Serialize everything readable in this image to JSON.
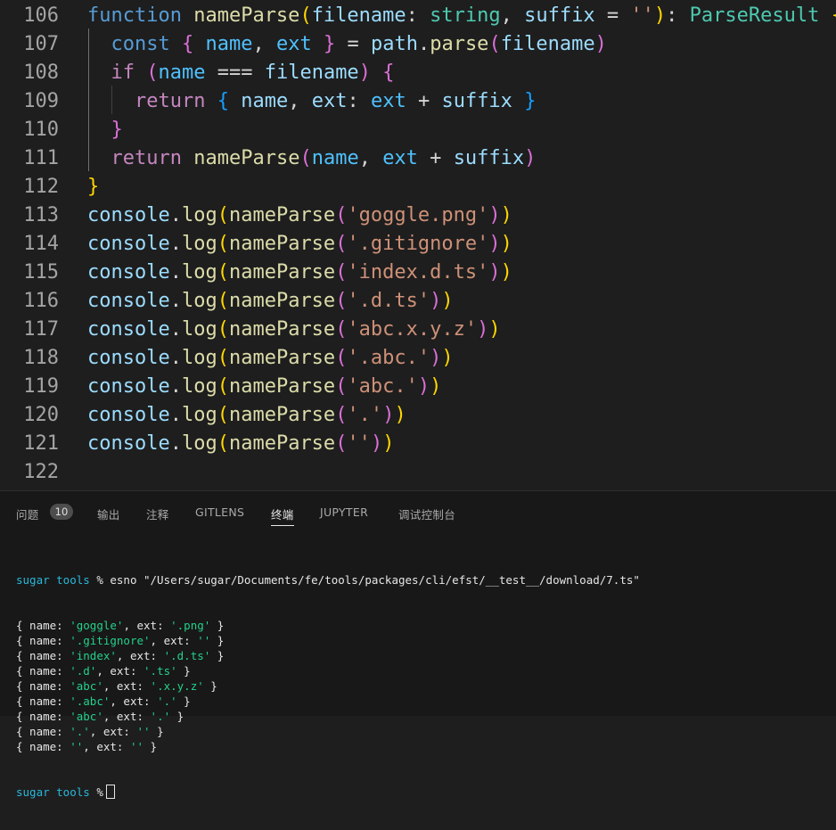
{
  "editor": {
    "lines": [
      {
        "num": "106",
        "tokens": [
          {
            "t": "function",
            "c": "kw"
          },
          {
            "t": " ",
            "c": "txt"
          },
          {
            "t": "nameParse",
            "c": "fn"
          },
          {
            "t": "(",
            "c": "b1"
          },
          {
            "t": "filename",
            "c": "var"
          },
          {
            "t": ": ",
            "c": "txt"
          },
          {
            "t": "string",
            "c": "type"
          },
          {
            "t": ", ",
            "c": "txt"
          },
          {
            "t": "suffix",
            "c": "var"
          },
          {
            "t": " = ",
            "c": "txt"
          },
          {
            "t": "''",
            "c": "str"
          },
          {
            "t": ")",
            "c": "b1"
          },
          {
            "t": ": ",
            "c": "txt"
          },
          {
            "t": "ParseResult",
            "c": "type"
          },
          {
            "t": " ",
            "c": "txt"
          },
          {
            "t": "{",
            "c": "b1"
          }
        ]
      },
      {
        "num": "107",
        "tokens": [
          {
            "t": "  ",
            "c": "txt"
          },
          {
            "t": "const",
            "c": "kw"
          },
          {
            "t": " ",
            "c": "txt"
          },
          {
            "t": "{",
            "c": "b2"
          },
          {
            "t": " ",
            "c": "txt"
          },
          {
            "t": "name",
            "c": "const"
          },
          {
            "t": ", ",
            "c": "txt"
          },
          {
            "t": "ext",
            "c": "const"
          },
          {
            "t": " ",
            "c": "txt"
          },
          {
            "t": "}",
            "c": "b2"
          },
          {
            "t": " = ",
            "c": "txt"
          },
          {
            "t": "path",
            "c": "var"
          },
          {
            "t": ".",
            "c": "txt"
          },
          {
            "t": "parse",
            "c": "fn"
          },
          {
            "t": "(",
            "c": "b2"
          },
          {
            "t": "filename",
            "c": "var"
          },
          {
            "t": ")",
            "c": "b2"
          }
        ]
      },
      {
        "num": "108",
        "tokens": [
          {
            "t": "  ",
            "c": "txt"
          },
          {
            "t": "if",
            "c": "ctl"
          },
          {
            "t": " ",
            "c": "txt"
          },
          {
            "t": "(",
            "c": "b2"
          },
          {
            "t": "name",
            "c": "const"
          },
          {
            "t": " === ",
            "c": "txt"
          },
          {
            "t": "filename",
            "c": "var"
          },
          {
            "t": ")",
            "c": "b2"
          },
          {
            "t": " ",
            "c": "txt"
          },
          {
            "t": "{",
            "c": "b2"
          }
        ]
      },
      {
        "num": "109",
        "tokens": [
          {
            "t": "    ",
            "c": "txt"
          },
          {
            "t": "return",
            "c": "ctl"
          },
          {
            "t": " ",
            "c": "txt"
          },
          {
            "t": "{",
            "c": "b3"
          },
          {
            "t": " ",
            "c": "txt"
          },
          {
            "t": "name",
            "c": "var"
          },
          {
            "t": ", ",
            "c": "txt"
          },
          {
            "t": "ext",
            "c": "var"
          },
          {
            "t": ": ",
            "c": "txt"
          },
          {
            "t": "ext",
            "c": "const"
          },
          {
            "t": " + ",
            "c": "txt"
          },
          {
            "t": "suffix",
            "c": "var"
          },
          {
            "t": " ",
            "c": "txt"
          },
          {
            "t": "}",
            "c": "b3"
          }
        ]
      },
      {
        "num": "110",
        "tokens": [
          {
            "t": "  ",
            "c": "txt"
          },
          {
            "t": "}",
            "c": "b2"
          }
        ]
      },
      {
        "num": "111",
        "tokens": [
          {
            "t": "  ",
            "c": "txt"
          },
          {
            "t": "return",
            "c": "ctl"
          },
          {
            "t": " ",
            "c": "txt"
          },
          {
            "t": "nameParse",
            "c": "fn"
          },
          {
            "t": "(",
            "c": "b2"
          },
          {
            "t": "name",
            "c": "const"
          },
          {
            "t": ", ",
            "c": "txt"
          },
          {
            "t": "ext",
            "c": "const"
          },
          {
            "t": " + ",
            "c": "txt"
          },
          {
            "t": "suffix",
            "c": "var"
          },
          {
            "t": ")",
            "c": "b2"
          }
        ]
      },
      {
        "num": "112",
        "tokens": [
          {
            "t": "}",
            "c": "b1"
          }
        ]
      },
      {
        "num": "113",
        "tokens": [
          {
            "t": "console",
            "c": "var"
          },
          {
            "t": ".",
            "c": "txt"
          },
          {
            "t": "log",
            "c": "fn"
          },
          {
            "t": "(",
            "c": "b1"
          },
          {
            "t": "nameParse",
            "c": "fn"
          },
          {
            "t": "(",
            "c": "b2"
          },
          {
            "t": "'goggle.png'",
            "c": "str"
          },
          {
            "t": ")",
            "c": "b2"
          },
          {
            "t": ")",
            "c": "b1"
          }
        ]
      },
      {
        "num": "114",
        "tokens": [
          {
            "t": "console",
            "c": "var"
          },
          {
            "t": ".",
            "c": "txt"
          },
          {
            "t": "log",
            "c": "fn"
          },
          {
            "t": "(",
            "c": "b1"
          },
          {
            "t": "nameParse",
            "c": "fn"
          },
          {
            "t": "(",
            "c": "b2"
          },
          {
            "t": "'.gitignore'",
            "c": "str"
          },
          {
            "t": ")",
            "c": "b2"
          },
          {
            "t": ")",
            "c": "b1"
          }
        ]
      },
      {
        "num": "115",
        "tokens": [
          {
            "t": "console",
            "c": "var"
          },
          {
            "t": ".",
            "c": "txt"
          },
          {
            "t": "log",
            "c": "fn"
          },
          {
            "t": "(",
            "c": "b1"
          },
          {
            "t": "nameParse",
            "c": "fn"
          },
          {
            "t": "(",
            "c": "b2"
          },
          {
            "t": "'index.d.ts'",
            "c": "str"
          },
          {
            "t": ")",
            "c": "b2"
          },
          {
            "t": ")",
            "c": "b1"
          }
        ]
      },
      {
        "num": "116",
        "tokens": [
          {
            "t": "console",
            "c": "var"
          },
          {
            "t": ".",
            "c": "txt"
          },
          {
            "t": "log",
            "c": "fn"
          },
          {
            "t": "(",
            "c": "b1"
          },
          {
            "t": "nameParse",
            "c": "fn"
          },
          {
            "t": "(",
            "c": "b2"
          },
          {
            "t": "'.d.ts'",
            "c": "str"
          },
          {
            "t": ")",
            "c": "b2"
          },
          {
            "t": ")",
            "c": "b1"
          }
        ]
      },
      {
        "num": "117",
        "tokens": [
          {
            "t": "console",
            "c": "var"
          },
          {
            "t": ".",
            "c": "txt"
          },
          {
            "t": "log",
            "c": "fn"
          },
          {
            "t": "(",
            "c": "b1"
          },
          {
            "t": "nameParse",
            "c": "fn"
          },
          {
            "t": "(",
            "c": "b2"
          },
          {
            "t": "'abc.x.y.z'",
            "c": "str"
          },
          {
            "t": ")",
            "c": "b2"
          },
          {
            "t": ")",
            "c": "b1"
          }
        ]
      },
      {
        "num": "118",
        "tokens": [
          {
            "t": "console",
            "c": "var"
          },
          {
            "t": ".",
            "c": "txt"
          },
          {
            "t": "log",
            "c": "fn"
          },
          {
            "t": "(",
            "c": "b1"
          },
          {
            "t": "nameParse",
            "c": "fn"
          },
          {
            "t": "(",
            "c": "b2"
          },
          {
            "t": "'.abc.'",
            "c": "str"
          },
          {
            "t": ")",
            "c": "b2"
          },
          {
            "t": ")",
            "c": "b1"
          }
        ]
      },
      {
        "num": "119",
        "tokens": [
          {
            "t": "console",
            "c": "var"
          },
          {
            "t": ".",
            "c": "txt"
          },
          {
            "t": "log",
            "c": "fn"
          },
          {
            "t": "(",
            "c": "b1"
          },
          {
            "t": "nameParse",
            "c": "fn"
          },
          {
            "t": "(",
            "c": "b2"
          },
          {
            "t": "'abc.'",
            "c": "str"
          },
          {
            "t": ")",
            "c": "b2"
          },
          {
            "t": ")",
            "c": "b1"
          }
        ]
      },
      {
        "num": "120",
        "tokens": [
          {
            "t": "console",
            "c": "var"
          },
          {
            "t": ".",
            "c": "txt"
          },
          {
            "t": "log",
            "c": "fn"
          },
          {
            "t": "(",
            "c": "b1"
          },
          {
            "t": "nameParse",
            "c": "fn"
          },
          {
            "t": "(",
            "c": "b2"
          },
          {
            "t": "'.'",
            "c": "str"
          },
          {
            "t": ")",
            "c": "b2"
          },
          {
            "t": ")",
            "c": "b1"
          }
        ]
      },
      {
        "num": "121",
        "tokens": [
          {
            "t": "console",
            "c": "var"
          },
          {
            "t": ".",
            "c": "txt"
          },
          {
            "t": "log",
            "c": "fn"
          },
          {
            "t": "(",
            "c": "b1"
          },
          {
            "t": "nameParse",
            "c": "fn"
          },
          {
            "t": "(",
            "c": "b2"
          },
          {
            "t": "''",
            "c": "str"
          },
          {
            "t": ")",
            "c": "b2"
          },
          {
            "t": ")",
            "c": "b1"
          }
        ]
      },
      {
        "num": "122",
        "tokens": []
      }
    ]
  },
  "panel": {
    "tabs": [
      {
        "label": "问题",
        "active": false
      },
      {
        "label": "输出",
        "active": false
      },
      {
        "label": "注释",
        "active": false
      },
      {
        "label": "GITLENS",
        "active": false
      },
      {
        "label": "终端",
        "active": true
      },
      {
        "label": "JUPYTER",
        "active": false
      },
      {
        "label": "调试控制台",
        "active": false
      }
    ],
    "problems_count": "10"
  },
  "terminal": {
    "command_prompt": "sugar tools",
    "command_symbol": " % ",
    "command": "esno \"/Users/sugar/Documents/fe/tools/packages/cli/efst/__test__/download/7.ts\"",
    "output": [
      {
        "name": "'goggle'",
        "ext": "'.png'"
      },
      {
        "name": "'.gitignore'",
        "ext": "''"
      },
      {
        "name": "'index'",
        "ext": "'.d.ts'"
      },
      {
        "name": "'.d'",
        "ext": "'.ts'"
      },
      {
        "name": "'abc'",
        "ext": "'.x.y.z'"
      },
      {
        "name": "'.abc'",
        "ext": "'.'"
      },
      {
        "name": "'abc'",
        "ext": "'.'"
      },
      {
        "name": "'.'",
        "ext": "''"
      },
      {
        "name": "''",
        "ext": "''"
      }
    ],
    "output_open": "{ name: ",
    "output_mid": ", ext: ",
    "output_close": " }",
    "final_prompt": "sugar tools",
    "final_symbol": " %"
  }
}
